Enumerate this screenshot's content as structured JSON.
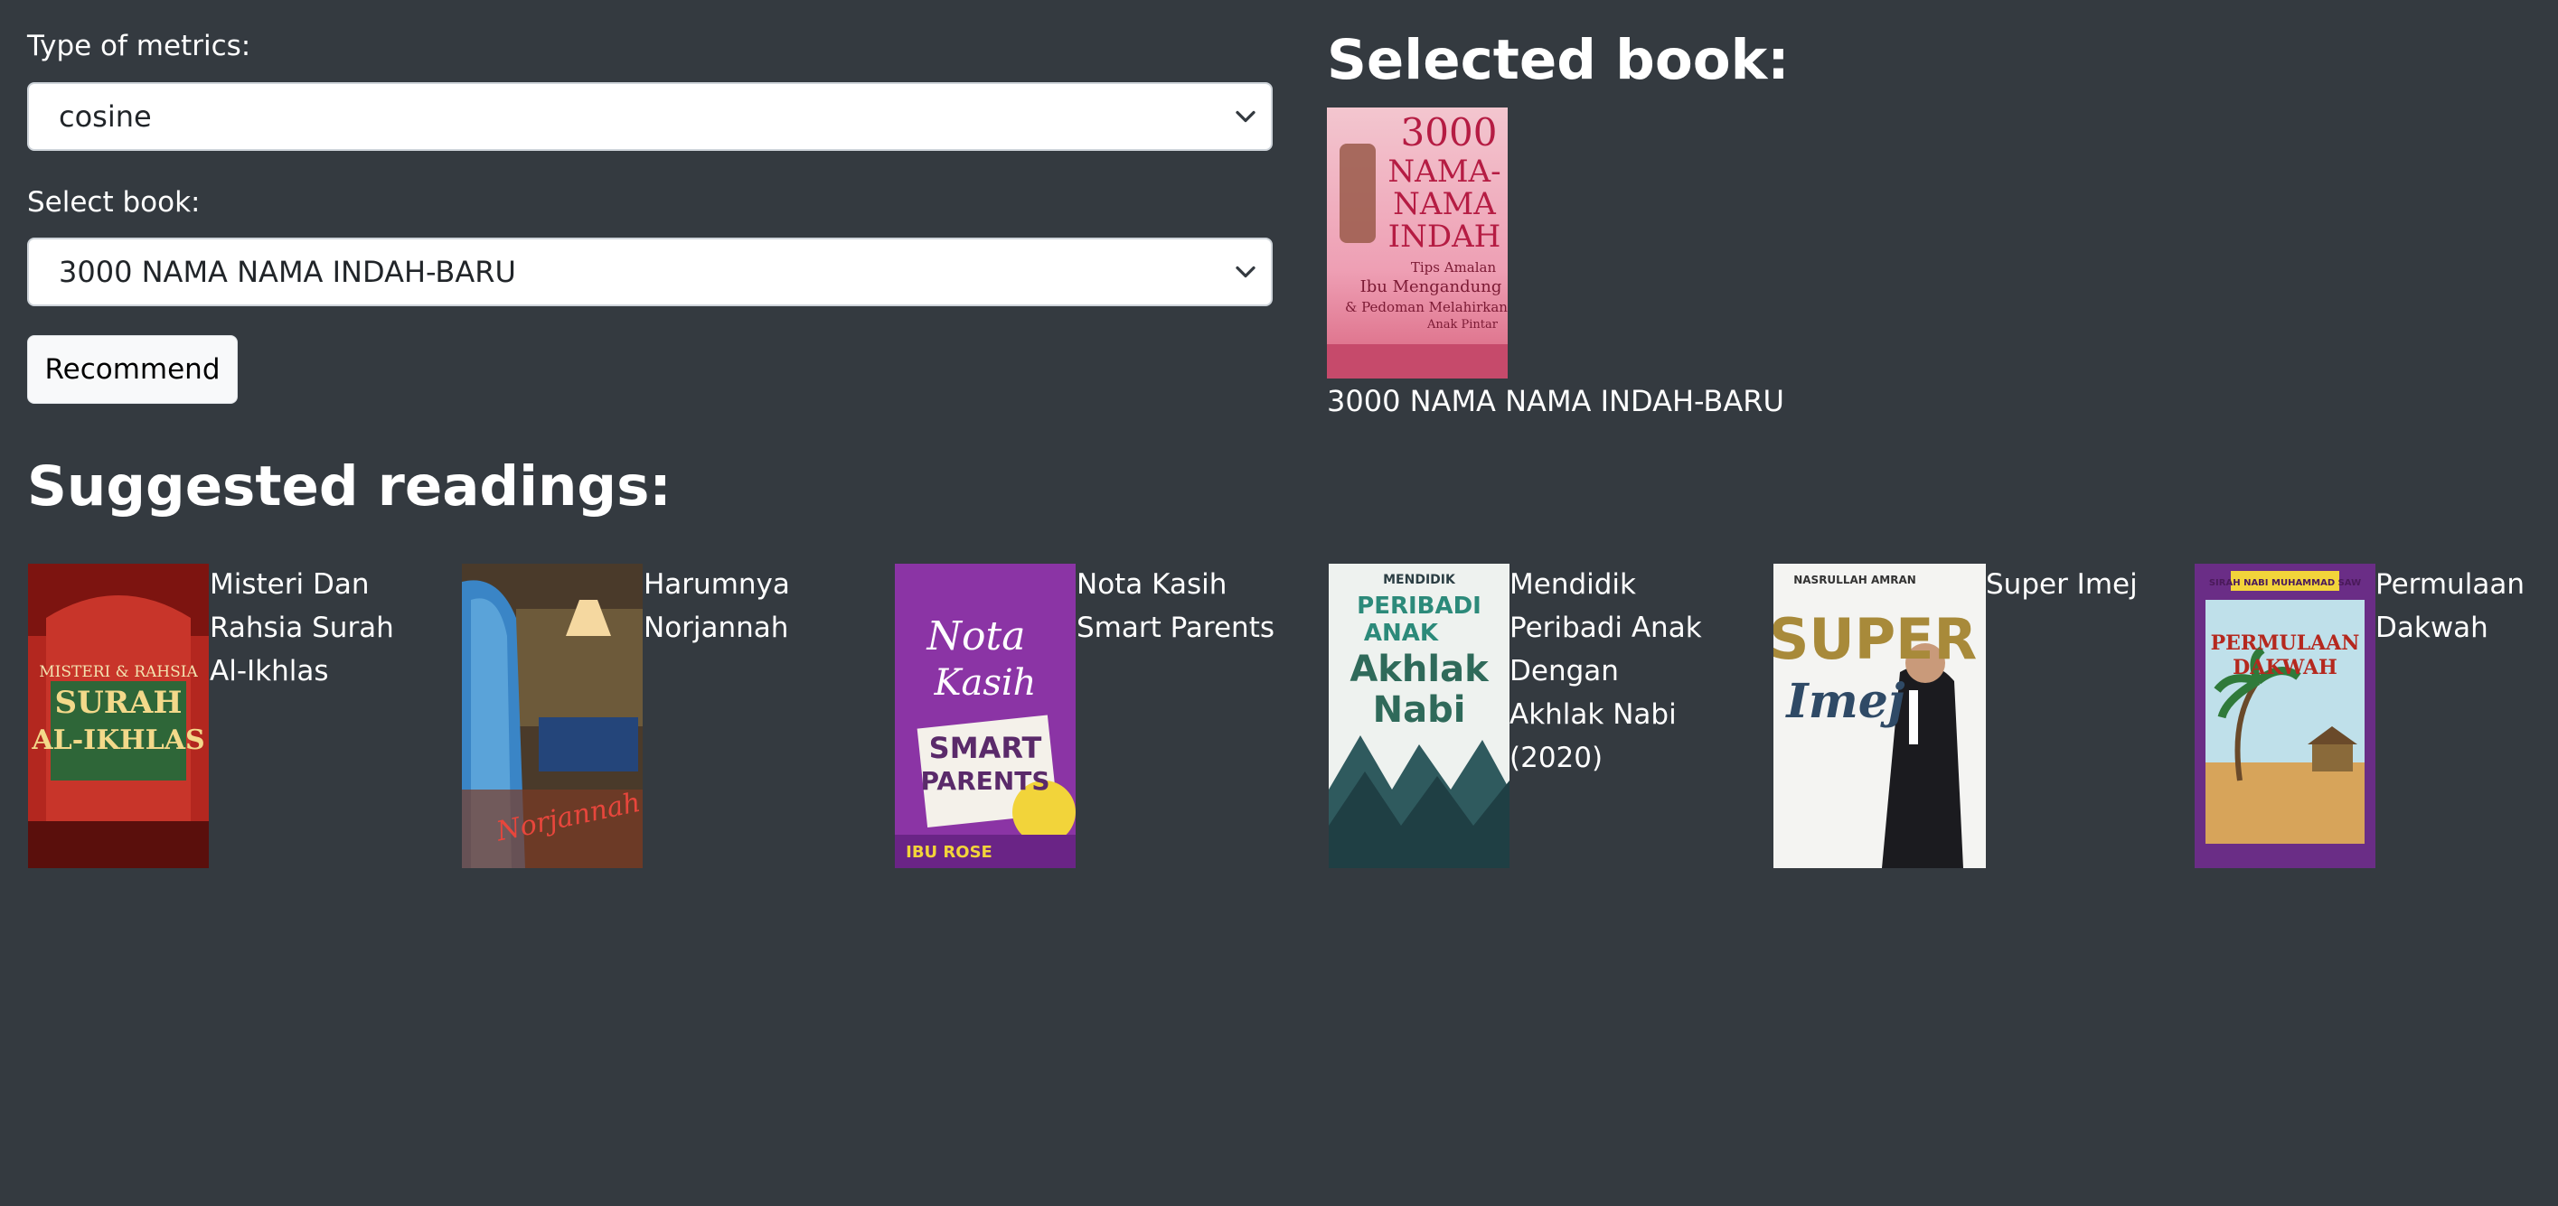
{
  "form": {
    "metric_label": "Type of metrics:",
    "metric_value": "cosine",
    "book_label": "Select book:",
    "book_value": "3000 NAMA NAMA INDAH-BARU",
    "recommend_label": "Recommend"
  },
  "selected": {
    "heading": "Selected book:",
    "title": "3000 NAMA NAMA INDAH-BARU",
    "cover_text": [
      "3000",
      "NAMA-",
      "NAMA",
      "INDAH",
      "Tips Amalan",
      "Ibu Mengandung",
      "& Pedoman Melahirkan",
      "Anak Pintar"
    ]
  },
  "suggested": {
    "heading": "Suggested readings:",
    "books": [
      {
        "title_lines": [
          "Misteri Dan",
          "Rahsia Surah",
          "Al-Ikhlas"
        ],
        "cover_text": [
          "MISTERI & RAHSIA",
          "SURAH",
          "AL-IKHLAS"
        ]
      },
      {
        "title_lines": [
          "Harumnya",
          "Norjannah"
        ],
        "cover_text": [
          "Norjannah"
        ]
      },
      {
        "title_lines": [
          "Nota Kasih",
          "Smart Parents"
        ],
        "cover_text": [
          "Nota",
          "Kasih",
          "SMART",
          "PARENTS",
          "IBU ROSE"
        ]
      },
      {
        "title_lines": [
          "Mendidik",
          "Peribadi Anak",
          "Dengan",
          "Akhlak Nabi",
          "(2020)"
        ],
        "cover_text": [
          "MENDIDIK",
          "PERIBADI",
          "ANAK",
          "Akhlak",
          "Nabi"
        ]
      },
      {
        "title_lines": [
          "Super Imej"
        ],
        "cover_text": [
          "NASRULLAH AMRAN",
          "SUPER",
          "Imej"
        ]
      },
      {
        "title_lines": [
          "Permulaan",
          "Dakwah"
        ],
        "cover_text": [
          "SIRAH NABI MUHAMMAD SAW",
          "PERMULAAN",
          "DAKWAH"
        ]
      }
    ]
  }
}
